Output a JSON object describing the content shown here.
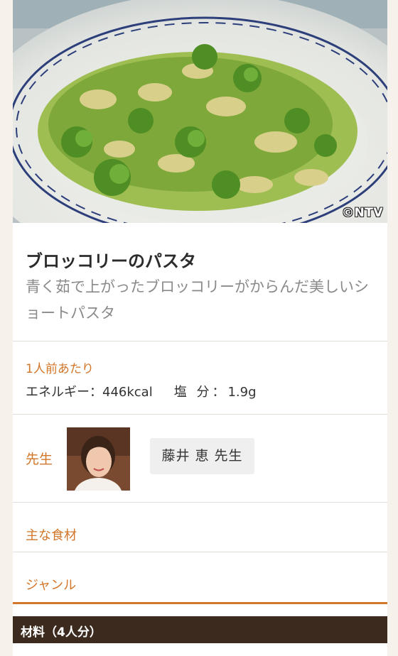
{
  "photo": {
    "alt_subject": "broccoli-pasta-photo",
    "watermark": "©NTV"
  },
  "recipe": {
    "title": "ブロッコリーのパスタ",
    "description": "青く茹で上がったブロッコリーがからんだ美しいショートパスタ"
  },
  "nutrition": {
    "heading": "1人前あたり",
    "energy_label": "エネルギー：",
    "energy_value": "446kcal",
    "salt_label": "塩 分：",
    "salt_value": "1.9g"
  },
  "teacher": {
    "label": "先生",
    "name": "藤井 恵 先生"
  },
  "sections": {
    "main_ingredients": "主な食材",
    "genre": "ジャンル",
    "materials": "材料（4人分）"
  },
  "colors": {
    "accent": "#d2762a",
    "dark_bar": "#3c2a1e",
    "background": "#f7f1ec"
  }
}
